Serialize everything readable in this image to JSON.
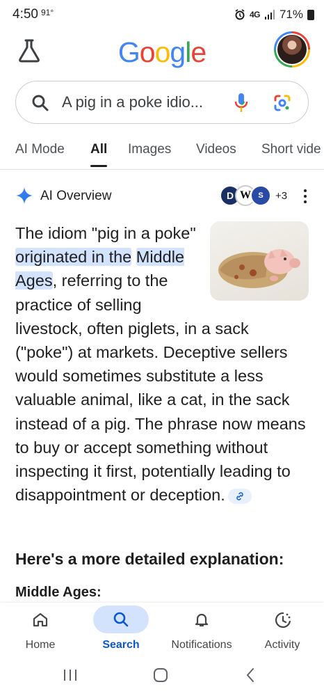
{
  "status_bar": {
    "time": "4:50",
    "temperature": "91°",
    "network": "4G",
    "battery": "71%"
  },
  "header": {
    "logo": "Google"
  },
  "search": {
    "query": "A pig in a poke idio..."
  },
  "tabs": [
    {
      "label": "AI Mode",
      "active": false
    },
    {
      "label": "All",
      "active": true
    },
    {
      "label": "Images",
      "active": false
    },
    {
      "label": "Videos",
      "active": false
    },
    {
      "label": "Short vide",
      "active": false
    }
  ],
  "ai_overview": {
    "title": "AI Overview",
    "sources_more": "+3",
    "source_badges": [
      "D",
      "W",
      "S"
    ],
    "text_part1": "The idiom \"pig in a poke\" ",
    "text_highlight1": "originated in the",
    "text_highlight2": "Middle Ages",
    "text_part2": ", referring to the practice of sell­ing livestock, often piglets, in a sack (\"poke\") at markets. Deceptive sell­ers would sometimes substitute a less valuable animal, like a cat, in the sack instead of a pig. The phrase now means to buy or accept some­thing without inspecting it first, po­tentially leading to disappointment or deception.",
    "subheading": "Here's a more detailed explanation:",
    "subheading2": "Middle Ages:"
  },
  "bottom_nav": [
    {
      "label": "Home",
      "icon": "home-icon",
      "active": false
    },
    {
      "label": "Search",
      "icon": "search-icon",
      "active": true
    },
    {
      "label": "Notifications",
      "icon": "bell-icon",
      "active": false
    },
    {
      "label": "Activity",
      "icon": "activity-icon",
      "active": false
    }
  ],
  "colors": {
    "accent": "#0b57d0",
    "highlight": "#d3e3fd"
  }
}
